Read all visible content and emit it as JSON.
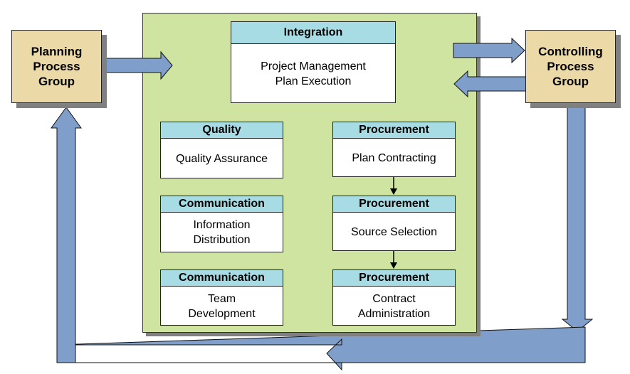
{
  "diagram": {
    "colors": {
      "group_fill": "#ecd9a8",
      "executing_fill": "#cfe4a0",
      "process_header_fill": "#a8dce4",
      "arrow_fill": "#7f9fca",
      "shadow": "#808080"
    },
    "planning_group": {
      "lines": [
        "Planning",
        "Process",
        "Group"
      ]
    },
    "controlling_group": {
      "lines": [
        "Controlling",
        "Process",
        "Group"
      ]
    },
    "processes": {
      "integration": {
        "area": "Integration",
        "lines": [
          "Project Management",
          "Plan Execution"
        ]
      },
      "quality": {
        "area": "Quality",
        "lines": [
          "Quality Assurance"
        ]
      },
      "communication_1": {
        "area": "Communication",
        "lines": [
          "Information",
          "Distribution"
        ]
      },
      "communication_2": {
        "area": "Communication",
        "lines": [
          "Team",
          "Development"
        ]
      },
      "procurement_1": {
        "area": "Procurement",
        "lines": [
          "Plan Contracting"
        ]
      },
      "procurement_2": {
        "area": "Procurement",
        "lines": [
          "Source Selection"
        ]
      },
      "procurement_3": {
        "area": "Procurement",
        "lines": [
          "Contract",
          "Administration"
        ]
      }
    },
    "flows": [
      {
        "from": "Planning Process Group",
        "to": "Executing Process Group"
      },
      {
        "from": "Executing Process Group",
        "to": "Controlling Process Group"
      },
      {
        "from": "Controlling Process Group",
        "to": "Executing Process Group"
      },
      {
        "from": "Controlling Process Group",
        "to": "Planning Process Group"
      },
      {
        "from": "Plan Contracting",
        "to": "Source Selection"
      },
      {
        "from": "Source Selection",
        "to": "Contract Administration"
      }
    ]
  }
}
